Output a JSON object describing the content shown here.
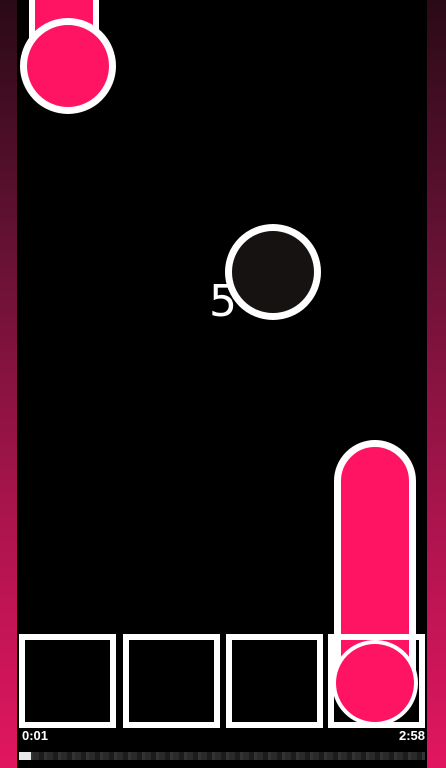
{
  "game": {
    "combo_count": "5",
    "time_elapsed": "0:01",
    "time_total": "2:58",
    "progress_fraction": 0.006,
    "lane_count": 4
  },
  "colors": {
    "note": "#ff1464",
    "outline": "#ffffff",
    "background": "#000000",
    "ball": "#161212"
  },
  "icons": {
    "top_note": "falling-note-icon",
    "ball": "ball-icon",
    "long_note": "hold-note-icon"
  }
}
